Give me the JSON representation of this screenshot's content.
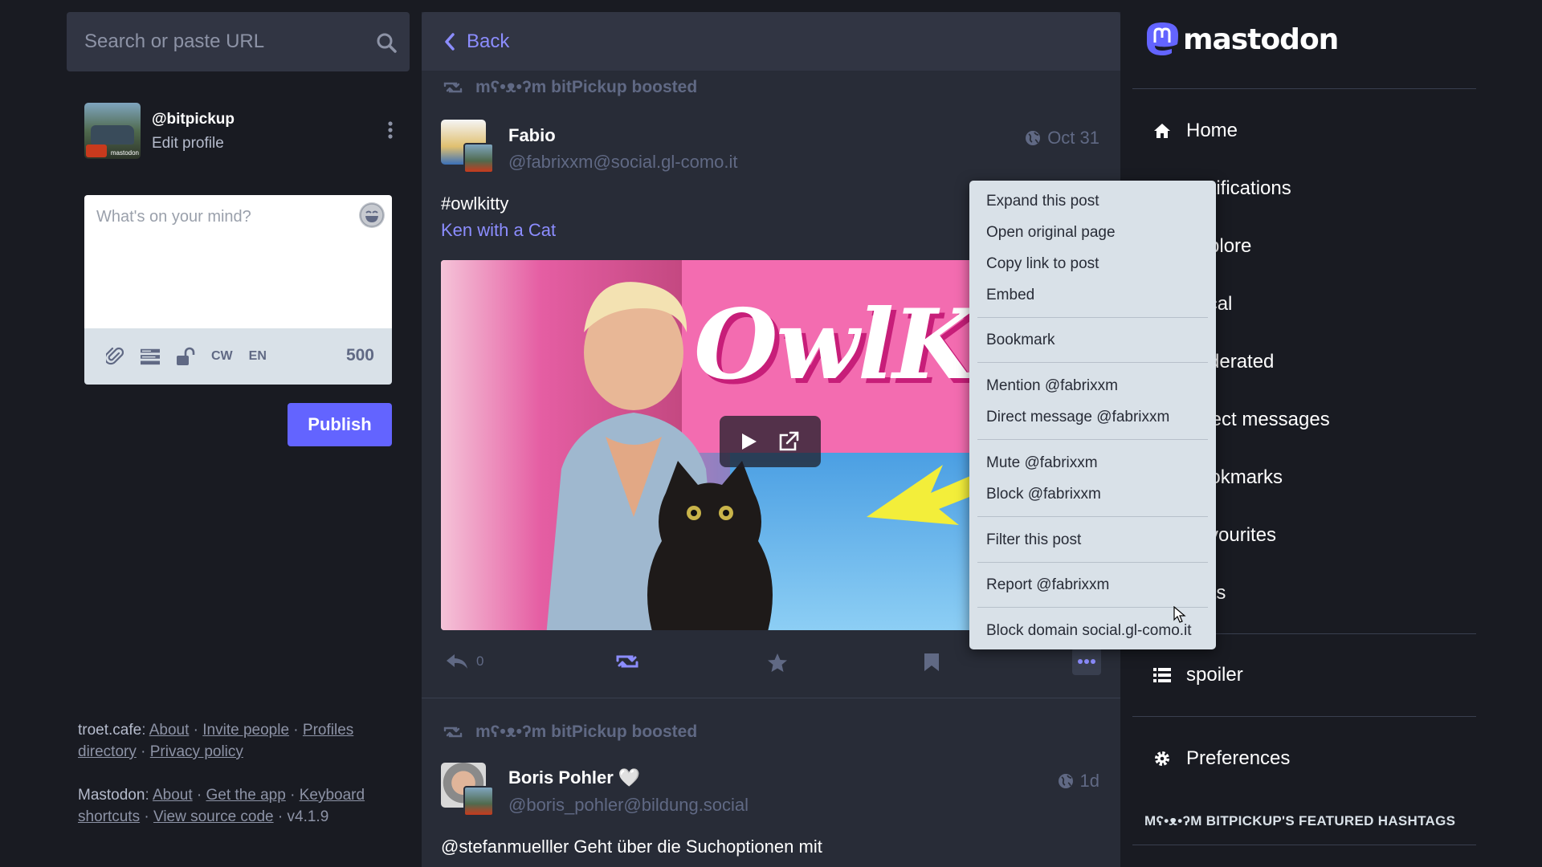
{
  "search": {
    "placeholder": "Search or paste URL"
  },
  "account": {
    "handle": "@bitpickup",
    "edit_label": "Edit profile",
    "avatar_tag": "mastodon"
  },
  "compose": {
    "placeholder": "What's on your mind?",
    "cw_label": "CW",
    "lang_label": "EN",
    "char_count": "500",
    "publish_label": "Publish"
  },
  "footer": {
    "server": "troet.cafe",
    "server_links": [
      "About",
      "Invite people",
      "Profiles directory",
      "Privacy policy"
    ],
    "mastodon": "Mastodon",
    "mastodon_links": [
      "About",
      "Get the app",
      "Keyboard shortcuts",
      "View source code"
    ],
    "version": "v4.1.9"
  },
  "column": {
    "back_label": "Back",
    "statuses": [
      {
        "boosted_by": "mʕ•ᴥ•ʔm bitPickup boosted",
        "author": "Fabio",
        "acct": "@fabrixxm@social.gl-como.it",
        "time": "Oct 31",
        "content_lines": [
          "#owlkitty"
        ],
        "link_text": "Ken with a Cat",
        "media_text": "OwlKit",
        "reply_count": "0"
      },
      {
        "boosted_by": "mʕ•ᴥ•ʔm bitPickup boosted",
        "author": "Boris Pohler 🤍",
        "acct": "@boris_pohler@bildung.social",
        "time": "1d",
        "content_lines": [
          "@stefanmuelller Geht über die Suchoptionen mit"
        ]
      }
    ]
  },
  "dropdown": {
    "items": [
      "Expand this post",
      "Open original page",
      "Copy link to post",
      "Embed",
      "Bookmark",
      "Mention @fabrixxm",
      "Direct message @fabrixxm",
      "Mute @fabrixxm",
      "Block @fabrixxm",
      "Filter this post",
      "Report @fabrixxm",
      "Block domain social.gl-como.it"
    ]
  },
  "nav": {
    "logo": "mastodon",
    "items": [
      {
        "label": "Home",
        "icon": "home-icon"
      },
      {
        "label": "Notifications",
        "icon": "bell-icon"
      },
      {
        "label": "Explore",
        "icon": "hashtag-icon"
      },
      {
        "label": "Local",
        "icon": "users-icon"
      },
      {
        "label": "Federated",
        "icon": "globe-icon"
      },
      {
        "label": "Direct messages",
        "icon": "at-icon"
      },
      {
        "label": "Bookmarks",
        "icon": "bookmark-icon"
      },
      {
        "label": "Favourites",
        "icon": "star-icon"
      },
      {
        "label": "Lists",
        "icon": "list-icon"
      },
      {
        "label": "spoiler",
        "icon": "list-icon"
      },
      {
        "label": "Preferences",
        "icon": "gear-icon"
      }
    ],
    "featured_heading": "Mʕ•ᴥ•ʔM BITPICKUP'S FEATURED HASHTAGS"
  },
  "colors": {
    "accent": "#6364ff",
    "link": "#8c8dff",
    "bg": "#191b22",
    "column": "#282c37"
  }
}
